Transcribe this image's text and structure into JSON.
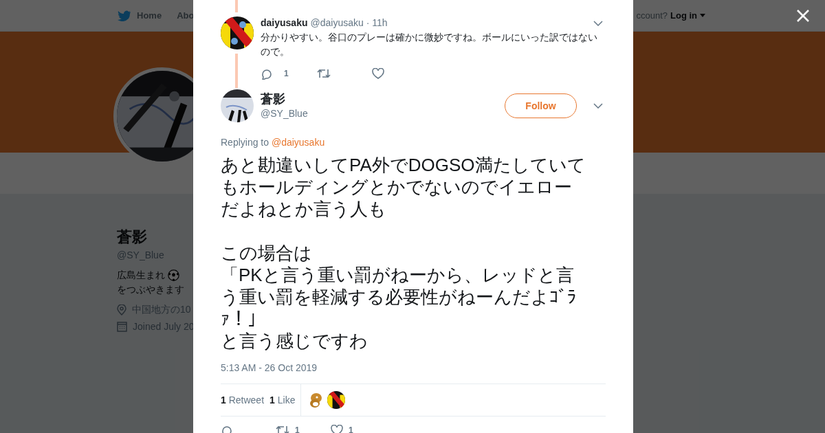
{
  "nav": {
    "items": [
      {
        "label": "Home",
        "selected": false
      },
      {
        "label": "Abo",
        "selected": false
      }
    ],
    "account_prompt": "ccount?",
    "login": "Log in"
  },
  "profile": {
    "name": "蒼影",
    "handle": "@SY_Blue",
    "bio_line_1": "広島生まれ",
    "bio_line_2": "をつぶやきます",
    "location": "中国地方の10",
    "joined": "Joined July 20"
  },
  "modal": {
    "parent_tweet": {
      "name": "daiyusaku",
      "handle": "@daiyusaku",
      "time": "· 11h",
      "text": "分かりやすい。谷口のプレーは確かに微妙ですね。ボールにいった訳ではないので。",
      "reply_count": "1"
    },
    "tweet": {
      "name": "蒼影",
      "handle": "@SY_Blue",
      "follow_label": "Follow",
      "replying_label": "Replying to",
      "replying_to": "@daiyusaku",
      "paragraphs": [
        [
          "あと勘違いしてPA外でDOGSO満たしていて",
          "もホールディングとかでないのでイエロー",
          "だよねとか言う人も"
        ],
        [
          "この場合は",
          "「PKと言う重い罰がねーから、レッドと言",
          "う重い罰を軽減する必要性がねーんだよｺﾞﾗ",
          "ｧ！」",
          "と言う感じですわ"
        ]
      ],
      "timestamp": "5:13 AM - 26 Oct 2019",
      "retweet_count": "1",
      "retweet_label": "Retweet",
      "like_count": "1",
      "like_label": "Like",
      "action_retweet_count": "1",
      "action_like_count": "1"
    }
  }
}
